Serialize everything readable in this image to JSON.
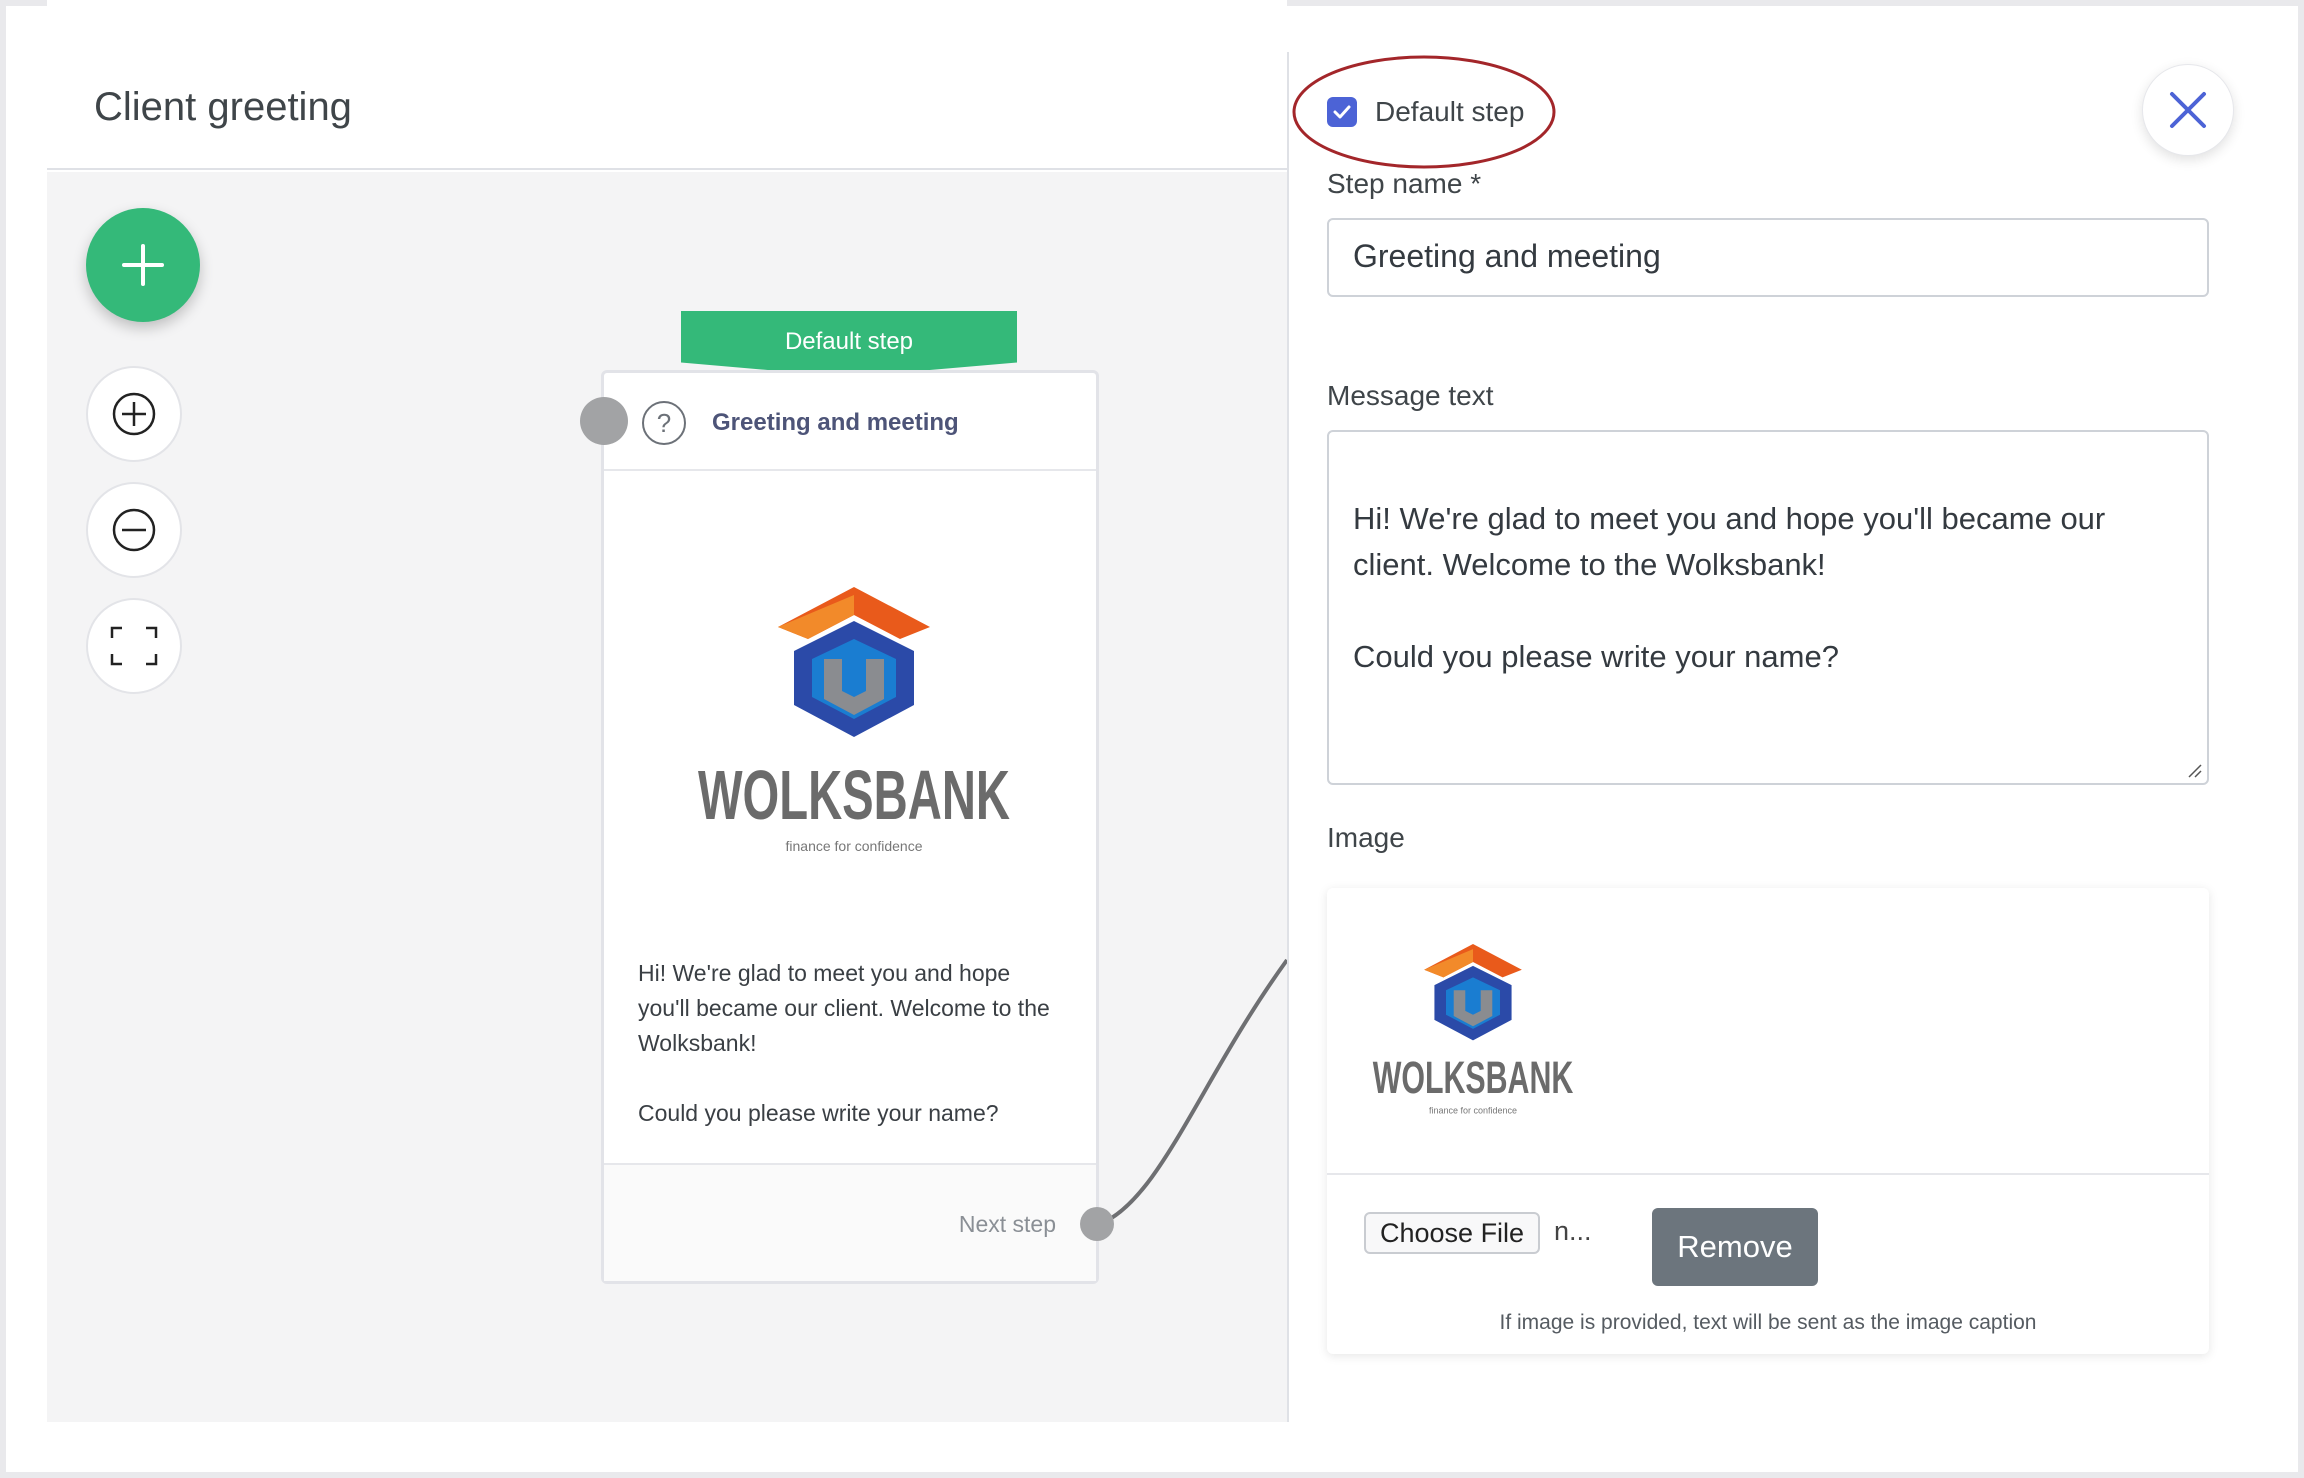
{
  "header": {
    "title": "Client greeting"
  },
  "toolbar": {
    "add_icon": "plus-icon",
    "zoom_in_icon": "zoom-in-icon",
    "zoom_out_icon": "zoom-out-icon",
    "fit_icon": "fit-screen-icon"
  },
  "node": {
    "tag": "Default step",
    "title": "Greeting and meeting",
    "message": "Hi! We're glad to meet you and hope you'll became our client. Welcome to the Wolksbank!\n\nCould you please write your name?",
    "next_label": "Next step",
    "logo": {
      "brand": "WOLKSBANK",
      "tagline": "finance for confidence"
    }
  },
  "panel": {
    "default_step_label": "Default step",
    "default_step_checked": true,
    "step_name_label": "Step name *",
    "step_name_value": "Greeting and meeting",
    "message_label": "Message text",
    "message_value": "Hi! We're glad to meet you and hope you'll became our client. Welcome to the Wolksbank!\n\nCould you please write your name?",
    "image_label": "Image",
    "choose_file_label": "Choose File",
    "file_name": "n...",
    "remove_label": "Remove",
    "image_hint": "If image is provided, text will be sent as the image caption"
  },
  "colors": {
    "accent_green": "#34b979",
    "checkbox_blue": "#4c63d6",
    "close_blue": "#4c63d6",
    "highlight_red": "#a3262a",
    "remove_gray": "#6c757d"
  }
}
